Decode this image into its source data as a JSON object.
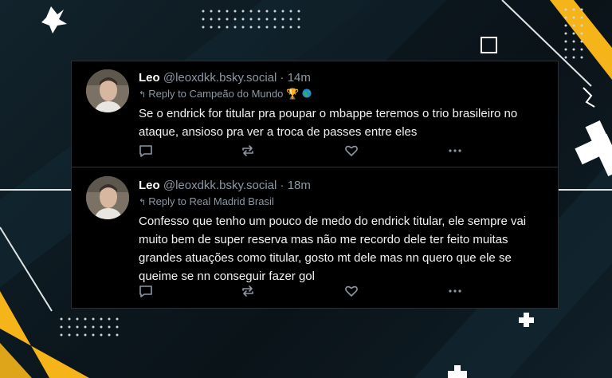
{
  "posts": [
    {
      "display_name": "Leo",
      "handle": "@leoxdkk.bsky.social",
      "separator": "·",
      "time": "14m",
      "reply_arrow": "↰",
      "reply_to": "Reply to Campeão do Mundo",
      "reply_badges": "🏆",
      "text": "Se o endrick for titular pra poupar o mbappe teremos o trio brasileiro no ataque, ansioso pra ver a troca de passes entre eles"
    },
    {
      "display_name": "Leo",
      "handle": "@leoxdkk.bsky.social",
      "separator": "·",
      "time": "18m",
      "reply_arrow": "↰",
      "reply_to": "Reply to Real Madrid Brasil",
      "text": "Confesso que tenho um pouco de medo do endrick titular, ele sempre vai muito bem de super reserva mas não me recordo dele ter feito muitas grandes atuações como titular, gosto mt dele mas nn quero que ele se queime se nn conseguir fazer gol"
    }
  ],
  "icons": {
    "reply": "reply-icon",
    "repost": "repost-icon",
    "like": "heart-icon",
    "more": "more-icon"
  },
  "colors": {
    "card_bg": "#000000",
    "meta_text": "#8b98a5",
    "body_text": "#f1f3f5",
    "accent_yellow": "#f5b41a"
  }
}
